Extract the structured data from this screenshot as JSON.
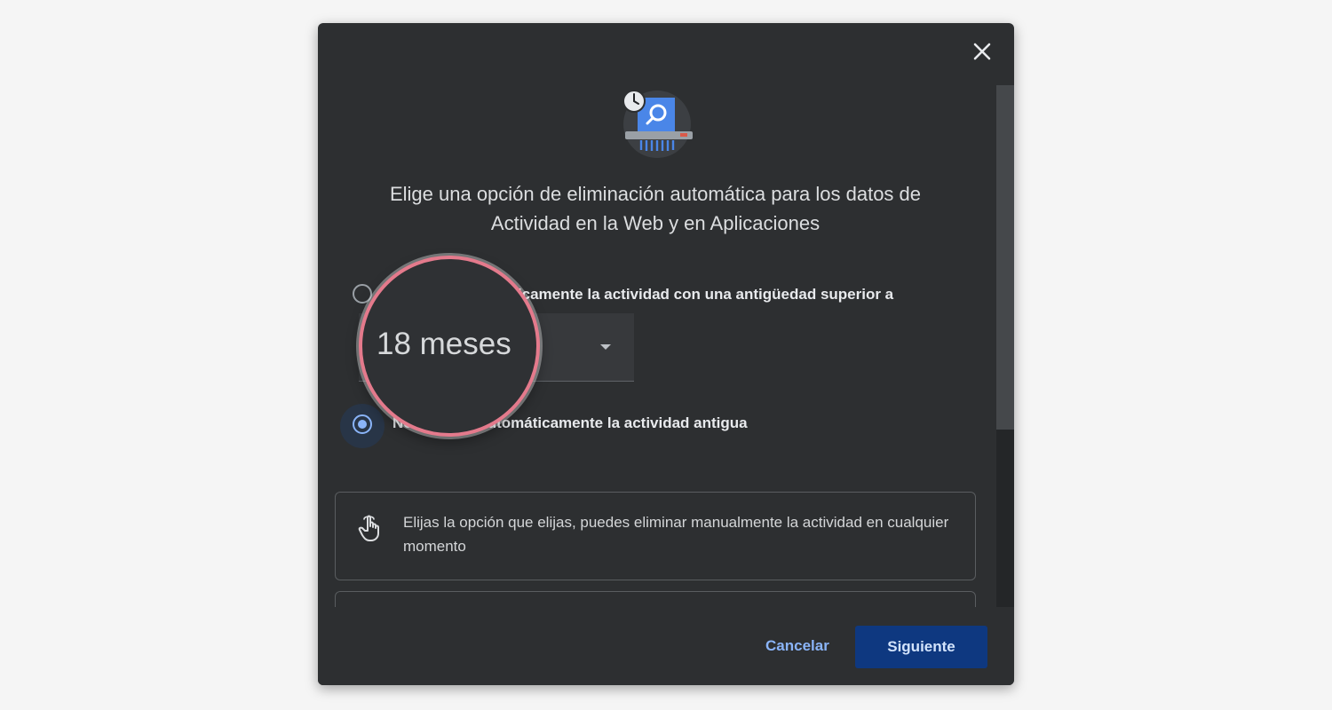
{
  "dialog": {
    "title": "Elige una opción de eliminación automática para los datos de Actividad en la Web y en Aplicaciones",
    "close_icon": "close-icon",
    "illustration_icon": "shredder-search-clock-icon"
  },
  "options": [
    {
      "label": "Eliminar automáticamente la actividad con una antigüedad superior a",
      "selected": false
    },
    {
      "label": "No eliminar automáticamente la actividad antigua",
      "selected": true
    }
  ],
  "dropdown": {
    "value": "18 meses"
  },
  "info": {
    "icon": "hand-pointer-icon",
    "text": "Elijas la opción que elijas, puedes eliminar manualmente la actividad en cualquier momento"
  },
  "footer": {
    "cancel_label": "Cancelar",
    "next_label": "Siguiente"
  },
  "magnifier": {
    "text": "18 meses"
  },
  "colors": {
    "accent": "#8ab4f8",
    "primary_button": "#0e3880",
    "dialog_bg": "#2d2f31",
    "magnifier_border": "#e47a8c"
  }
}
